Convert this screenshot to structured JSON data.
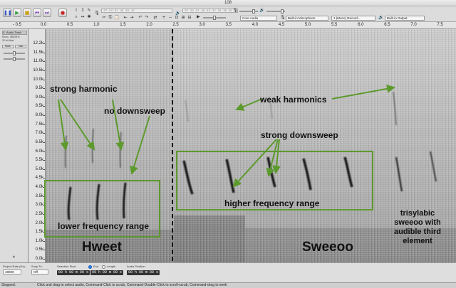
{
  "window": {
    "title": "108",
    "traffic_lights": [
      "#fc605b",
      "#fdbc40",
      "#34c84a"
    ]
  },
  "toolbar": {
    "pause_icon": "pause-icon",
    "play_icon": "play-icon",
    "stop_icon": "stop-icon",
    "skip_start_icon": "skip-to-start-icon",
    "skip_end_icon": "skip-to-end-icon",
    "record_icon": "record-icon",
    "host": "Core Audio",
    "input_device": "Built-in Microphone",
    "channels": "1 (Mono) Record...",
    "output_device": "Built-in Output",
    "meter_scale_rec": "-57 -54 -51 -48 -45 -42",
    "meter_scale_play": "-57 -54 -51 -48 -45 -42 -39 -36 -30 -27 -24 -21 -18 -15 -12 -9 -6 -3 0"
  },
  "ruler": {
    "ticks": [
      "- 0.5",
      "0.0",
      "0.5",
      "1.0",
      "1.5",
      "2.0",
      "2.5",
      "3.0",
      "3.5",
      "4.0",
      "4.5",
      "5.0",
      "5.5",
      "6.0",
      "6.5",
      "7.0",
      "7.5"
    ]
  },
  "track": {
    "name": "Audio Track",
    "close_symbol": "X",
    "info_line1": "Mono, 48000Hz",
    "info_line2": "32-bit float",
    "mute_label": "Mute",
    "solo_label": "Solo",
    "collapse_symbol": "▲"
  },
  "vscale": {
    "labels": [
      "12.2k",
      "11.5k",
      "11.0k",
      "10.5k",
      "10.0k",
      "9.5k",
      "9.0k",
      "8.5k",
      "8.0k",
      "7.5k",
      "7.0k",
      "6.5k",
      "6.0k",
      "5.5k",
      "5.0k",
      "4.5k",
      "4.0k",
      "3.5k",
      "3.0k",
      "2.5k",
      "2.0k",
      "1.5k",
      "1.0k",
      "0.5k",
      "0.0k"
    ]
  },
  "annotations": {
    "strong_harmonic": "strong harmonic",
    "no_downsweep": "no downsweep",
    "weak_harmonics": "weak harmonics",
    "strong_downsweep": "strong downsweep",
    "higher_frequency_range": "higher frequency range",
    "lower_frequency_range": "lower frequency range",
    "hweet": "Hweet",
    "sweeoo": "Sweeoo",
    "trisyllabic": [
      "trisylabic",
      "sweeoo with",
      "audible third",
      "element"
    ],
    "annotation_color": "#5d9a2d"
  },
  "selection_bar": {
    "project_rate_label": "Project Rate (Hz):",
    "project_rate_value": "48000",
    "snap_to_label": "Snap To:",
    "snap_to_value": "Off",
    "selection_start_label": "Selection Start:",
    "end_label": "End",
    "length_label": "Length",
    "start_value": "00 h 00 m 00 s",
    "end_value": "00 h 00 m 00 s",
    "audio_position_label": "Audio Position:",
    "audio_position_value": "00 h 00 m 00 s"
  },
  "status": {
    "state": "Stopped.",
    "hint": "Click and drag to select audio, Command-Click to scrub, Command-Double-Click to scroll-scrub, Command-drag to seek"
  }
}
